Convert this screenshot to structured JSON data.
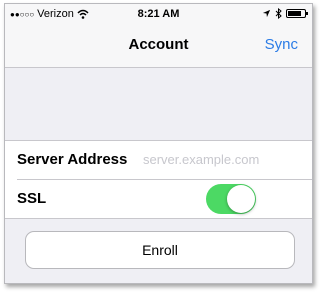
{
  "status_bar": {
    "signal": "●●○○○",
    "carrier": "Verizon",
    "time": "8:21 AM"
  },
  "nav": {
    "title": "Account",
    "sync_label": "Sync"
  },
  "form": {
    "server_label": "Server Address",
    "server_placeholder": "server.example.com",
    "server_value": "",
    "ssl_label": "SSL",
    "ssl_enabled": true
  },
  "enroll_label": "Enroll",
  "colors": {
    "accent": "#2b7ce6",
    "toggle_on": "#4cd964"
  },
  "icons": [
    "wifi-icon",
    "location-arrow-icon",
    "bluetooth-icon",
    "battery-icon"
  ]
}
